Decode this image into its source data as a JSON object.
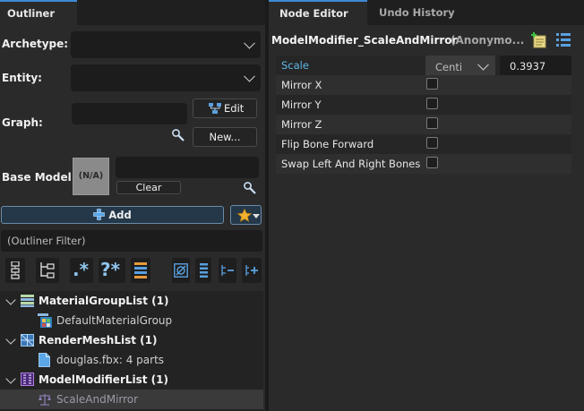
{
  "left_tabs": {
    "outliner": "Outliner"
  },
  "right_tabs": {
    "node_editor": "Node Editor",
    "undo_history": "Undo History"
  },
  "outliner": {
    "archetype_label": "Archetype:",
    "entity_label": "Entity:",
    "graph_label": "Graph:",
    "edit_button": "Edit",
    "new_button": "New...",
    "base_model_label": "Base Model:",
    "base_model_placeholder": "(N/A)",
    "clear_button": "Clear",
    "add_button": "Add",
    "filter_placeholder": "(Outliner Filter)"
  },
  "tree": [
    {
      "label": "MaterialGroupList (1)",
      "bold": true
    },
    {
      "label": "DefaultMaterialGroup",
      "bold": false
    },
    {
      "label": "RenderMeshList (1)",
      "bold": true
    },
    {
      "label": "douglas.fbx: 4 parts",
      "bold": false
    },
    {
      "label": "ModelModifierList (1)",
      "bold": true
    },
    {
      "label": "ScaleAndMirror",
      "bold": false
    }
  ],
  "node_editor": {
    "title": "ModelModifier_ScaleAndMirror",
    "subtitle": "(Anonymo...",
    "scale_label": "Scale",
    "scale_unit": "Centi",
    "scale_value": "0.3937",
    "properties": [
      "Mirror X",
      "Mirror Y",
      "Mirror Z",
      "Flip Bone Forward",
      "Swap Left And Right Bones"
    ]
  },
  "colors": {
    "accent": "#3f8ad6",
    "scale_label": "#5fb7e8",
    "panel": "#2a2a2a"
  }
}
